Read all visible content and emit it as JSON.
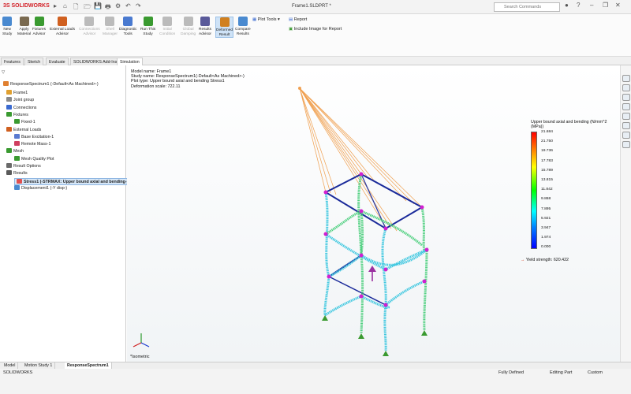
{
  "app": {
    "brand_prefix": "3S",
    "brand_name": "SOLIDWORKS",
    "doc_title": "Frame1.SLDPRT *",
    "search_placeholder": "Search Commands"
  },
  "ribbon": {
    "buttons": [
      {
        "label": "New\nStudy",
        "icon": "new-study-icon",
        "enabled": true
      },
      {
        "label": "Apply\nMaterial",
        "icon": "material-icon",
        "enabled": true
      },
      {
        "label": "Fixtures\nAdvisor",
        "icon": "fixtures-icon",
        "enabled": true
      },
      {
        "label": "External Loads\nAdvisor",
        "icon": "loads-icon",
        "enabled": true
      },
      {
        "label": "Connections\nAdvisor",
        "icon": "connections-icon",
        "enabled": false
      },
      {
        "label": "Shell\nManager",
        "icon": "shell-icon",
        "enabled": false
      },
      {
        "label": "Diagnostic\nTools",
        "icon": "diagnostic-icon",
        "enabled": true
      },
      {
        "label": "Run This\nStudy",
        "icon": "run-icon",
        "enabled": true
      },
      {
        "label": "Initial\nCondition",
        "icon": "initial-icon",
        "enabled": false
      },
      {
        "label": "Global\nDamping",
        "icon": "damping-icon",
        "enabled": false
      },
      {
        "label": "Results\nAdvisor",
        "icon": "results-icon",
        "enabled": true
      },
      {
        "label": "Deformed\nResult",
        "icon": "deformed-icon",
        "enabled": true,
        "selected": true
      },
      {
        "label": "Compare\nResults",
        "icon": "compare-icon",
        "enabled": true
      }
    ],
    "plot_tools": "Plot Tools",
    "report": "Report",
    "include_image": "Include Image for Report"
  },
  "cm_tabs": [
    "Features",
    "Sketch",
    "Evaluate",
    "SOLIDWORKS Add-Ins",
    "Simulation"
  ],
  "cm_active": "Simulation",
  "tree": {
    "root": "ResponseSpectrum1 (-Default<As Machined>-)",
    "items": [
      {
        "label": "Frame1",
        "indent": 1
      },
      {
        "label": "Joint group",
        "indent": 1
      },
      {
        "label": "Connections",
        "indent": 1
      },
      {
        "label": "Fixtures",
        "indent": 1
      },
      {
        "label": "Fixed-1",
        "indent": 2
      },
      {
        "label": "External Loads",
        "indent": 1
      },
      {
        "label": "Base Excitation-1",
        "indent": 2
      },
      {
        "label": "Remote Mass-1",
        "indent": 2
      },
      {
        "label": "Mesh",
        "indent": 1
      },
      {
        "label": "Mesh Quality Plot",
        "indent": 2
      },
      {
        "label": "Result Options",
        "indent": 1
      },
      {
        "label": "Results",
        "indent": 1
      },
      {
        "label": "Stress1 (-STRMAX: Upper bound axial and bending-)",
        "indent": 2,
        "selected": true
      },
      {
        "label": "Displacement1 (-Y disp-)",
        "indent": 2
      }
    ]
  },
  "viewport": {
    "info": [
      "Model name: Frame1",
      "Study name: ResponseSpectrum1(-Default<As Machined>-)",
      "Plot type: Upper bound axial and bending Stress1",
      "Deformation scale: 722.11"
    ],
    "view_label": "*Isometric",
    "legend_title": "Upper bound axial and bending (N/mm^2 (MPa))",
    "legend_ticks": [
      "21.684",
      "21.750",
      "19.736",
      "17.783",
      "15.789",
      "13.815",
      "11.842",
      "9.868",
      "7.895",
      "5.921",
      "3.947",
      "1.974",
      "0.000"
    ],
    "yield_label": "Yield strength: 620.422"
  },
  "bottom_tabs": [
    "Model",
    "Motion Study 1",
    "ResponseSpectrum1"
  ],
  "bottom_active": "ResponseSpectrum1",
  "status": {
    "app": "SOLIDWORKS",
    "state": "Fully Defined",
    "mode": "Editing Part",
    "units": "Custom"
  },
  "colors": {
    "brand": "#d21f26",
    "frame_blue": "#1a2a9a",
    "cable": "#f0a050",
    "node": "#d020d0",
    "mesh_green": "#50d080",
    "mesh_cyan": "#40c8e0"
  }
}
